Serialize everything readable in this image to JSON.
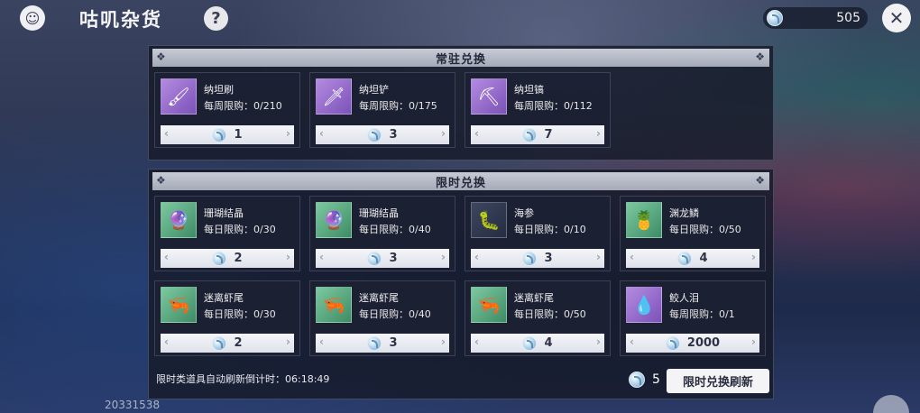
{
  "header": {
    "title": "咕叽杂货",
    "help_label": "?",
    "currency_amount": "505",
    "close_label": "✕"
  },
  "regular": {
    "title": "常驻兑换",
    "items": [
      {
        "name": "纳坦刷",
        "limit": "每周限购：0/210",
        "price": "1",
        "icon": "brush-icon",
        "bg": "purple",
        "glyph": "🖌"
      },
      {
        "name": "纳坦铲",
        "limit": "每周限购：0/175",
        "price": "3",
        "icon": "shovel-icon",
        "bg": "purple",
        "glyph": "🗡"
      },
      {
        "name": "纳坦镐",
        "limit": "每周限购：0/112",
        "price": "7",
        "icon": "pickaxe-icon",
        "bg": "purple",
        "glyph": "⛏"
      }
    ]
  },
  "limited": {
    "title": "限时兑换",
    "items": [
      {
        "name": "珊瑚结晶",
        "limit": "每日限购：0/30",
        "price": "2",
        "icon": "coral-crystal-icon",
        "bg": "green",
        "glyph": "🔮"
      },
      {
        "name": "珊瑚结晶",
        "limit": "每日限购：0/40",
        "price": "3",
        "icon": "coral-crystal-icon",
        "bg": "green",
        "glyph": "🔮"
      },
      {
        "name": "海参",
        "limit": "每日限购：0/10",
        "price": "3",
        "icon": "sea-cucumber-icon",
        "bg": "gray",
        "glyph": "🐛"
      },
      {
        "name": "渊龙鳞",
        "limit": "每日限购：0/50",
        "price": "4",
        "icon": "dragon-scale-icon",
        "bg": "green",
        "glyph": "🍍"
      },
      {
        "name": "迷离虾尾",
        "limit": "每日限购：0/30",
        "price": "2",
        "icon": "shrimp-tail-icon",
        "bg": "green",
        "glyph": "🦐"
      },
      {
        "name": "迷离虾尾",
        "limit": "每日限购：0/40",
        "price": "3",
        "icon": "shrimp-tail-icon",
        "bg": "green",
        "glyph": "🦐"
      },
      {
        "name": "迷离虾尾",
        "limit": "每日限购：0/50",
        "price": "4",
        "icon": "shrimp-tail-icon",
        "bg": "green",
        "glyph": "🦐"
      },
      {
        "name": "鲛人泪",
        "limit": "每周限购：0/1",
        "price": "2000",
        "icon": "mermaid-tear-icon",
        "bg": "purple",
        "glyph": "💧"
      }
    ],
    "refresh_text": "限时类道具自动刷新倒计时：06:18:49",
    "refresh_cost": "5",
    "refresh_button": "限时兑换刷新"
  },
  "uid": "20331538"
}
